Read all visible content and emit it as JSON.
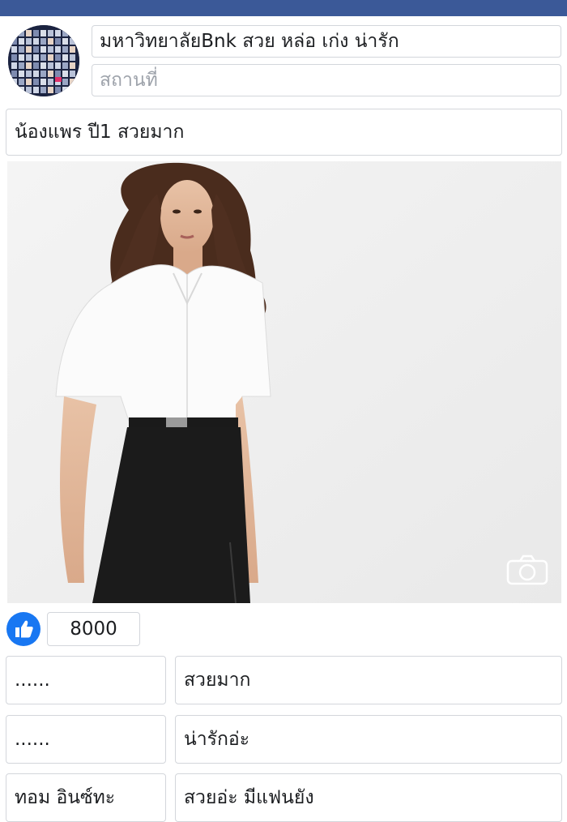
{
  "post": {
    "title": "มหาวิทยาลัยBnk สวย หล่อ เก่ง น่ารัก",
    "location_placeholder": "สถานที่",
    "caption": "น้องแพร ปี1 สวยมาก"
  },
  "reactions": {
    "like_count": "8000"
  },
  "comments": [
    {
      "name": "......",
      "text": "สวยมาก"
    },
    {
      "name": "......",
      "text": "น่ารักอ่ะ"
    },
    {
      "name": "ทอม อินซ์ทะ",
      "text": "สวยอ่ะ มีแฟนยัง"
    }
  ],
  "colors": {
    "topbar": "#3b5998",
    "like_blue": "#1877f2",
    "border": "#d3d6db",
    "placeholder": "#9ea3ab"
  },
  "icons": {
    "like": "thumbs-up-icon",
    "camera": "camera-icon"
  }
}
